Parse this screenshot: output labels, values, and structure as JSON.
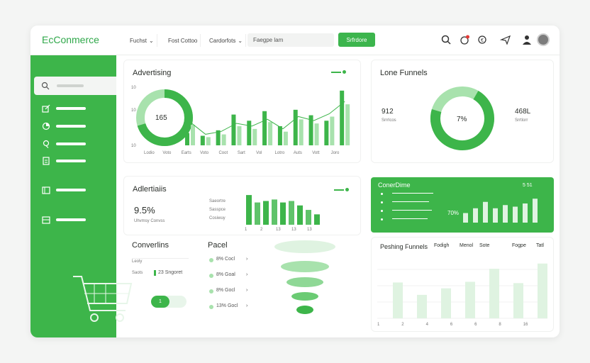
{
  "brand": "EcConmerce",
  "topbar": {
    "dropdown1": "Fuchst",
    "dropdown2": "Fost Cottoo",
    "dropdown3": "Cardorfots",
    "search_placeholder": "Faegpe lam",
    "cta": "Srfrdore"
  },
  "advertising": {
    "title": "Advertising",
    "donut_value": "165",
    "y_ticks": [
      "10",
      "10",
      "10"
    ],
    "x_ticks": [
      "Lodio",
      "Voto",
      "Earts",
      "Voto",
      "Coot",
      "Sart",
      "Vol",
      "Lotro",
      "Auts",
      "Vott",
      "Joro"
    ]
  },
  "adverts": {
    "title": "Adlertiaiis",
    "kpi": "9.5%",
    "kpi_sub": "Uhvmsy Convss",
    "labels": [
      "Saeortre",
      "Sasspce",
      "Cosiwuy"
    ],
    "x_ticks": [
      "1",
      "2",
      "13",
      "13",
      "13"
    ]
  },
  "conversions": {
    "title": "Converlins",
    "rows": [
      {
        "k": "Leoly",
        "v": ""
      },
      {
        "k": "Saots",
        "v": "23 Sngoret"
      }
    ],
    "toggle_label": "1"
  },
  "panel": {
    "title": "Pacel",
    "items": [
      "8% Cocl",
      "8% Goal",
      "8% Gocl",
      "13% Gocl"
    ]
  },
  "funnels": {
    "title": "Lone Funnels",
    "left_value": "912",
    "left_sub": "Srrrlcos",
    "donut_value": "7%",
    "right_value": "468L",
    "right_sub": "Srrtlorr"
  },
  "conversion_card": {
    "title": "ConerDime",
    "controls": "5 51",
    "percent": "70%"
  },
  "pending": {
    "title": "Peshing Funnels",
    "cols": [
      "Fodigh",
      "Menol",
      "Sote",
      "Fogpe",
      "Tatl"
    ],
    "x_ticks": [
      "1",
      "2",
      "4",
      "6",
      "6",
      "8",
      "16"
    ]
  },
  "colors": {
    "primary": "#3db54a",
    "light": "#a8e2ad",
    "pale": "#dff3e1"
  },
  "chart_data": [
    {
      "type": "bar",
      "title": "Advertising",
      "categories": [
        "Lodio",
        "Voto",
        "Earts",
        "Voto",
        "Coot",
        "Sart",
        "Vol",
        "Lotro",
        "Auts",
        "Vott",
        "Joro"
      ],
      "series": [
        {
          "values": [
            18,
            14,
            22,
            45,
            36,
            50,
            28,
            52,
            44,
            36,
            80
          ]
        },
        {
          "values": [
            30,
            12,
            16,
            28,
            24,
            34,
            20,
            38,
            32,
            42,
            60
          ]
        }
      ],
      "ylim": [
        0,
        85
      ]
    },
    {
      "type": "bar",
      "title": "Adlertiaiis",
      "categories": [
        "1",
        "2",
        "13",
        "13",
        "13"
      ],
      "values": [
        40,
        30,
        32,
        34,
        30,
        32,
        26,
        20,
        14
      ]
    },
    {
      "type": "bar",
      "title": "ConerDime",
      "values": [
        12,
        18,
        26,
        18,
        22,
        20,
        24,
        30
      ]
    },
    {
      "type": "bar",
      "title": "Peshing Funnels",
      "categories": [
        "1",
        "2",
        "4",
        "6",
        "6",
        "8",
        "16"
      ],
      "values": [
        55,
        36,
        46,
        56,
        76,
        54,
        84
      ],
      "ylim": [
        0,
        100
      ]
    }
  ]
}
